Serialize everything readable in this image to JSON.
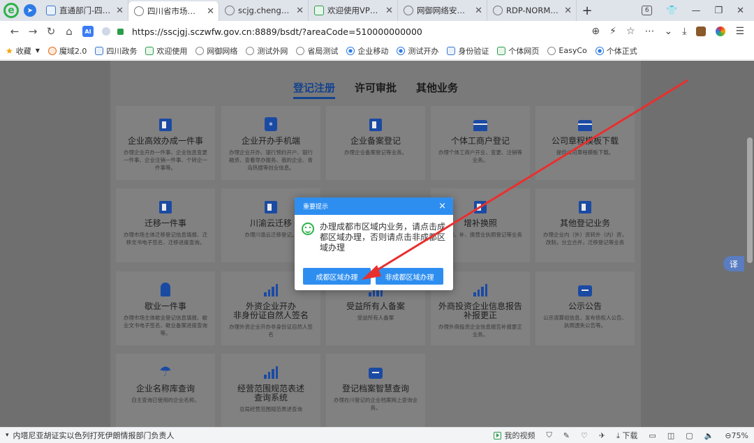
{
  "browser": {
    "tabs": [
      {
        "label": "直通部门-四川政",
        "active": false,
        "icon": "gov-icon"
      },
      {
        "label": "四川省市场监督管",
        "active": true,
        "icon": "globe-icon"
      },
      {
        "label": "scjg.chengdu.g",
        "active": false,
        "icon": "globe-icon"
      },
      {
        "label": "欢迎使用VPN安",
        "active": false,
        "icon": "shield-icon"
      },
      {
        "label": "网御网络安全审",
        "active": false,
        "icon": "globe-icon"
      },
      {
        "label": "RDP-NORMAL-",
        "active": false,
        "icon": "globe-icon"
      }
    ],
    "tab_count": "6",
    "url": "https://sscjgj.sczwfw.gov.cn:8889/bsdt/?areaCode=510000000000",
    "ai_label": "AI",
    "bookmarks": [
      {
        "label": "收藏",
        "icon": "star-icon"
      },
      {
        "label": "魔域2.0",
        "icon": "orange"
      },
      {
        "label": "四川政务",
        "icon": "gov"
      },
      {
        "label": "欢迎使用",
        "icon": "shield"
      },
      {
        "label": "网御网络",
        "icon": "globe"
      },
      {
        "label": "测试外网",
        "icon": "globe"
      },
      {
        "label": "省局测试",
        "icon": "globe"
      },
      {
        "label": "企业移动",
        "icon": "dot"
      },
      {
        "label": "测试开办",
        "icon": "dot"
      },
      {
        "label": "身份验证",
        "icon": "gov"
      },
      {
        "label": "个体网页",
        "icon": "shield"
      },
      {
        "label": "EasyCo",
        "icon": "globe"
      },
      {
        "label": "个体正式",
        "icon": "dot"
      }
    ]
  },
  "page": {
    "subtabs": [
      "登记注册",
      "许可审批",
      "其他业务"
    ],
    "cards": [
      {
        "title": "企业高效办成一件事",
        "desc": "办理企业开办一件事、企业信息变更一件事、企业注销一件事、个转企一件事等。",
        "icon": "building"
      },
      {
        "title": "企业开办手机端",
        "desc": "办理企业开办、银行预约开户、银行融资、查看导办服务、我的企业、青岛热搜等创业信息。",
        "icon": "phone"
      },
      {
        "title": "企业备案登记",
        "desc": "办理企业备案登记等业务。",
        "icon": "building"
      },
      {
        "title": "个体工商户登记",
        "desc": "办理个体工商户开业、变更、注销等业务。",
        "icon": "store"
      },
      {
        "title": "公司章程模板下载",
        "desc": "提供公司章程模板下载。",
        "icon": "store"
      },
      {
        "title": "迁移一件事",
        "desc": "办理市场主体迁移登记信息填报、迁移文书电子签名、迁移进度查询。",
        "icon": "building"
      },
      {
        "title": "川渝云迁移",
        "desc": "办理川渝云迁移登记。",
        "icon": "building"
      },
      {
        "title": "增补换照",
        "desc": "办理增、补、换营业执照登记等业务",
        "icon": "building"
      },
      {
        "title": "其他登记业务",
        "desc": "办理企业内（外）资转外（内）资，改制，分立合并，迁移登记等业务",
        "icon": "building"
      },
      {
        "title": "歇业一件事",
        "desc": "办理市场主体歇业登记信息填报、歇业文书电子签名、歇业备案进度查询等。",
        "icon": "badge"
      },
      {
        "title": "外资企业开办\n非身份证自然人签名",
        "desc": "办理外资企业开办非身份证自然人签名",
        "icon": "chart"
      },
      {
        "title": "受益所有人备案",
        "desc": "受益所有人备案",
        "icon": "chart"
      },
      {
        "title": "外商投资企业信息报告\n补报更正",
        "desc": "办理外商投资企业信息报告补报更正业务。",
        "icon": "chart"
      },
      {
        "title": "公示公告",
        "desc": "公示清算组信息、发布债权人公告、执照遗失公告等。",
        "icon": "case"
      },
      {
        "title": "企业名称库查询",
        "desc": "自主查询已使用的企业名称。",
        "icon": "umbrella"
      },
      {
        "title": "经营范围规范表述\n查询系统",
        "desc": "总局经营范围规范表述查询",
        "icon": "chart"
      },
      {
        "title": "登记档案智慧查询",
        "desc": "办理在川登记的企业档案网上查询业务。",
        "icon": "case"
      }
    ],
    "float_translate": "译"
  },
  "modal": {
    "title": "重要提示",
    "close": "×",
    "message": "办理成都市区域内业务，请点击成都区域办理，否则请点击非成都区域办理",
    "btn_primary": "成都区域办理",
    "btn_secondary": "非成都区域办理"
  },
  "statusbar": {
    "news": "内塔尼亚胡证实以色列打死伊朗情报部门负责人",
    "video": "我的视频",
    "download": "下载",
    "zoom": "75%"
  },
  "colors": {
    "accent": "#2e8ef0",
    "nav_active": "#14438f",
    "icon_blue": "#1b4aa3",
    "annotation_arrow": "#e8302f"
  }
}
